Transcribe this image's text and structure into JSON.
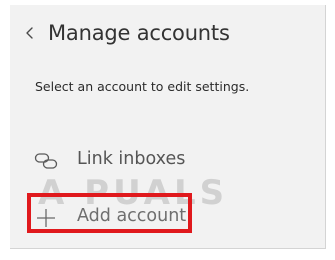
{
  "header": {
    "back_icon": "chevron-left-icon",
    "title": "Manage accounts"
  },
  "instruction": "Select an account to edit settings.",
  "menu": {
    "link_inboxes": {
      "icon": "link-icon",
      "label": "Link inboxes"
    },
    "add_account": {
      "icon": "plus-icon",
      "label": "Add account"
    }
  },
  "watermark": "A  PUALS",
  "colors": {
    "panel_background": "#f2f2f2",
    "highlight_border": "#e0191d",
    "title_text": "#333333",
    "item_text": "#555555"
  }
}
